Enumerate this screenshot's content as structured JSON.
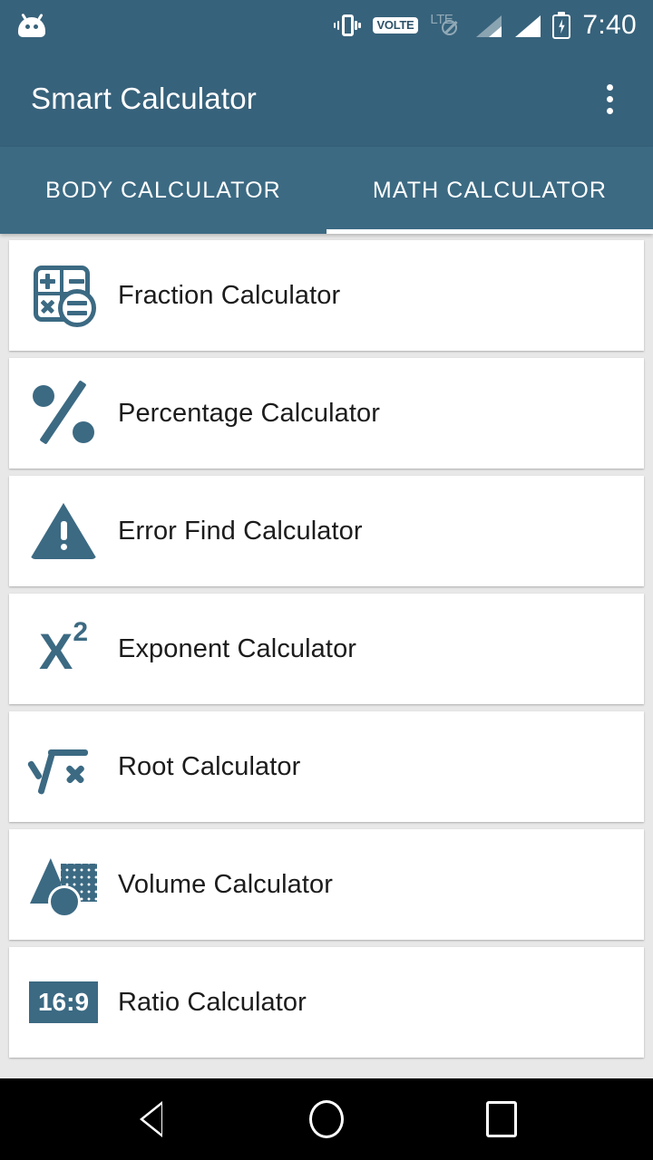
{
  "status_bar": {
    "app_notification_icon": "android-head-icon",
    "vibrate_icon": "vibrate-icon",
    "volte_label": "VOLTE",
    "lte_label": "LTE",
    "lte_state_icon": "no-data-ban-icon",
    "signal_1_icon": "signal-bars-dim-icon",
    "signal_2_icon": "signal-bars-full-icon",
    "battery_icon": "battery-charging-icon",
    "time": "7:40"
  },
  "app_bar": {
    "title": "Smart Calculator",
    "overflow_icon": "overflow-menu-icon"
  },
  "tabs": [
    {
      "label": "BODY CALCULATOR",
      "active": false
    },
    {
      "label": "MATH CALCULATOR",
      "active": true
    }
  ],
  "list": {
    "items": [
      {
        "label": "Fraction Calculator",
        "icon": "fraction-calculator-icon"
      },
      {
        "label": "Percentage Calculator",
        "icon": "percentage-icon"
      },
      {
        "label": "Error Find Calculator",
        "icon": "warning-triangle-icon"
      },
      {
        "label": "Exponent Calculator",
        "icon": "exponent-x-squared-icon",
        "glyph_base": "X",
        "glyph_sup": "2"
      },
      {
        "label": "Root Calculator",
        "icon": "square-root-icon"
      },
      {
        "label": "Volume Calculator",
        "icon": "geometric-shapes-icon"
      },
      {
        "label": "Ratio Calculator",
        "icon": "ratio-badge-icon",
        "badge_text": "16:9"
      }
    ]
  },
  "nav_bar": {
    "back_label": "back-icon",
    "home_label": "home-icon",
    "recents_label": "recents-icon"
  },
  "colors": {
    "primary": "#37627b",
    "primary_tabs": "#3c6a83",
    "accent_icon": "#3c6a83",
    "background": "#e8e8e8",
    "card": "#ffffff",
    "text": "#1c1c1c",
    "nav_bar": "#000000"
  }
}
